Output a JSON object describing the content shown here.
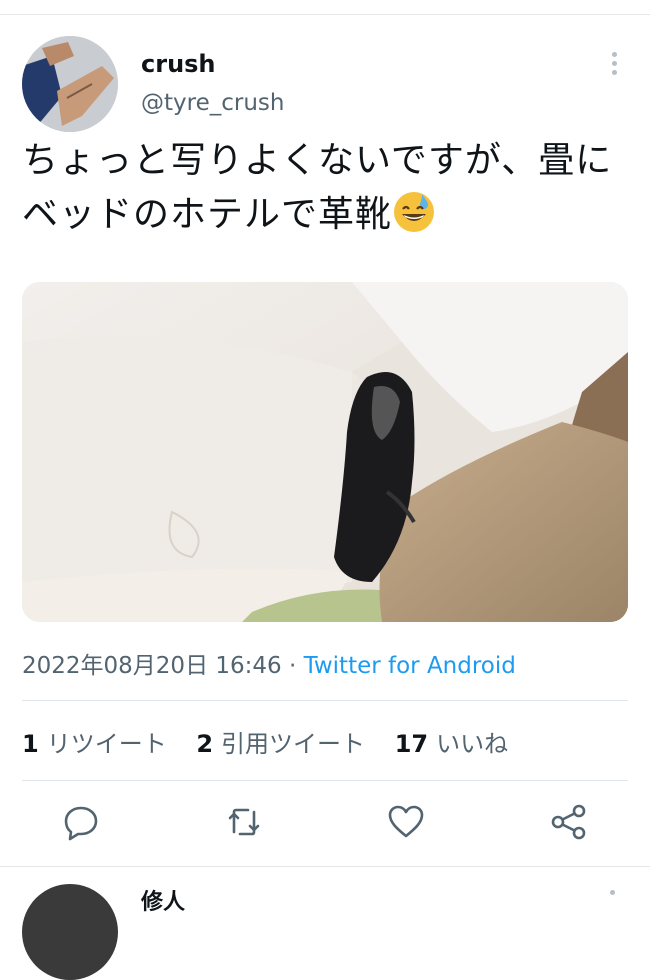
{
  "tweet": {
    "author": {
      "display_name": "crush",
      "handle": "@tyre_crush"
    },
    "text": "ちょっと写りよくないですが、畳にベッドのホテルで革靴",
    "emoji": "grinning-face-with-sweat-emoji",
    "timestamp": "2022年08月20日 16:46",
    "separator": "·",
    "source": "Twitter for Android",
    "stats": {
      "retweets": {
        "count": "1",
        "label": "リツイート"
      },
      "quotes": {
        "count": "2",
        "label": "引用ツイート"
      },
      "likes": {
        "count": "17",
        "label": "いいね"
      }
    }
  },
  "actions": [
    "reply-icon",
    "retweet-icon",
    "like-icon",
    "share-icon"
  ],
  "next_tweet": {
    "display_name": "修人"
  },
  "colors": {
    "link": "#1d9bf0",
    "secondary_text": "#536471",
    "icon": "#536471"
  }
}
